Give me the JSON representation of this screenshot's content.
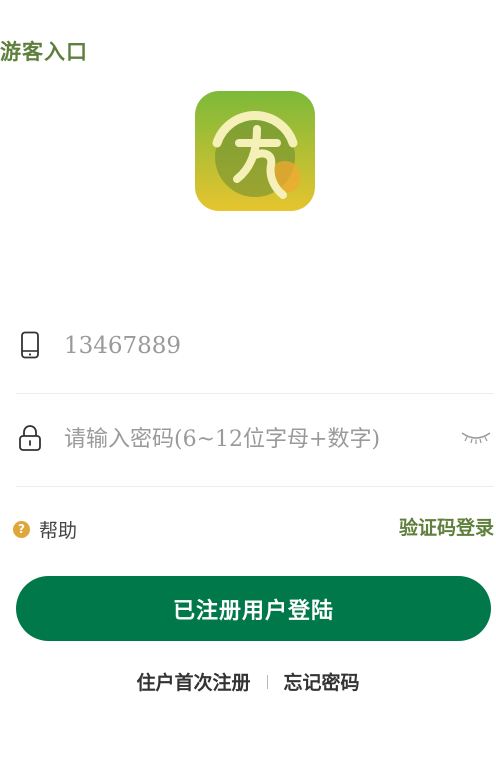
{
  "header": {
    "guest_entry": "游客入口"
  },
  "logo": {
    "icon": "app-logo-icon",
    "colors": {
      "top": "#7cb93a",
      "bottom": "#e6c42e",
      "ring": "#f4f0b8"
    }
  },
  "phone": {
    "value": "13467889",
    "icon": "mobile-phone-icon"
  },
  "password": {
    "placeholder": "请输入密码(6~12位字母+数字)",
    "icon": "lock-icon",
    "toggle_icon": "eye-closed-icon"
  },
  "help": {
    "badge": "?",
    "label": "帮助"
  },
  "sms_login": "验证码登录",
  "login_button": "已注册用户登陆",
  "links": {
    "register": "住户首次注册",
    "forgot": "忘记密码"
  },
  "colors": {
    "primary": "#00784a",
    "accent_text": "#5f7f3c",
    "help_badge": "#e0a63a"
  }
}
